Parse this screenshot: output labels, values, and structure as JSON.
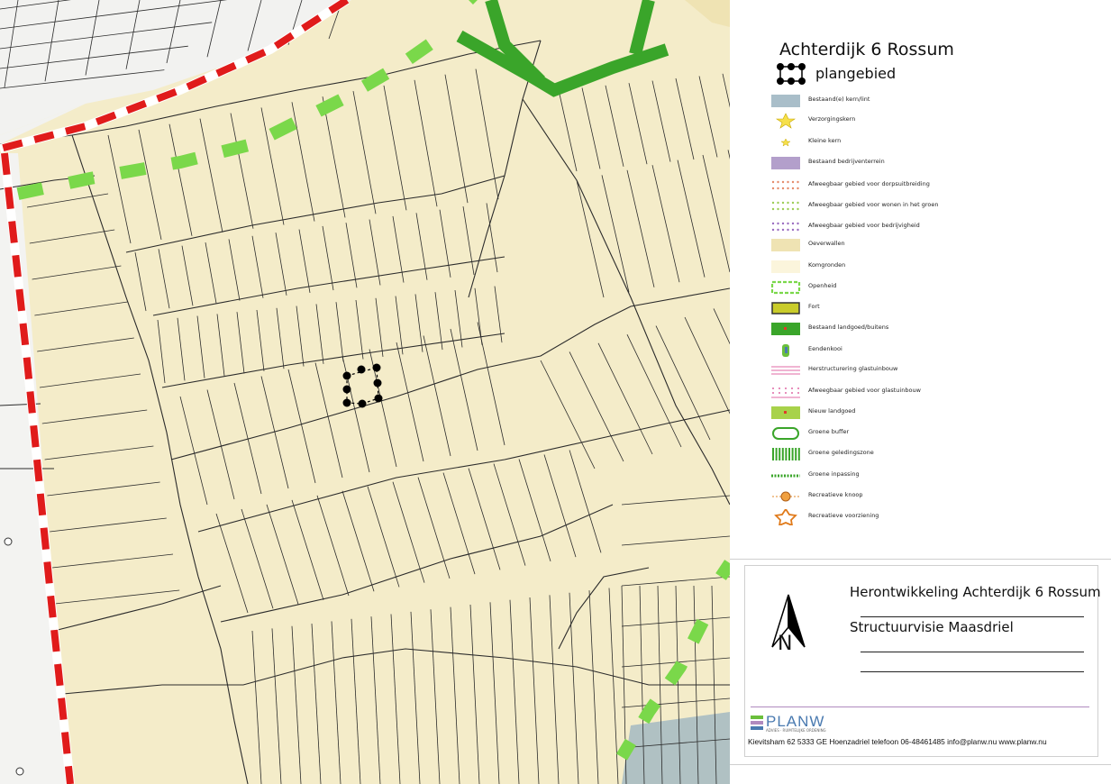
{
  "legend": {
    "title": "Achterdijk 6 Rossum",
    "plan_label": "plangebied",
    "items": [
      {
        "label": "Bestaand(e) kern/lint",
        "symbol": "fill",
        "color": "#a9bec9"
      },
      {
        "label": "Verzorgingskern",
        "symbol": "star-yellow-large"
      },
      {
        "label": "Kleine kern",
        "symbol": "star-yellow-small"
      },
      {
        "label": "Bestaand bedrijventerrein",
        "symbol": "fill",
        "color": "#b39fcb"
      },
      {
        "label": "Afweegbaar gebied voor dorpsuitbreiding",
        "symbol": "dots",
        "color": "#e58a6a"
      },
      {
        "label": "Afweegbaar gebied voor wonen in het groen",
        "symbol": "dots",
        "color": "#9ccc55"
      },
      {
        "label": "Afweegbaar gebied voor bedrijvigheid",
        "symbol": "dots",
        "color": "#9a6cc0"
      },
      {
        "label": "Oeverwallen",
        "symbol": "fill",
        "color": "#efe3b3"
      },
      {
        "label": "Komgronden",
        "symbol": "fill",
        "color": "#fbf5dc"
      },
      {
        "label": "Openheid",
        "symbol": "dashed-green"
      },
      {
        "label": "Fort",
        "symbol": "fort"
      },
      {
        "label": "Bestaand landgoed/buitens",
        "symbol": "landgoed"
      },
      {
        "label": "Eendenkooi",
        "symbol": "eendenkooi"
      },
      {
        "label": "Herstructurering glastuinbouw",
        "symbol": "pink-lines"
      },
      {
        "label": "Afweegbaar gebied voor glastuinbouw",
        "symbol": "pink-dots"
      },
      {
        "label": "Nieuw landgoed",
        "symbol": "nieuw-landgoed"
      },
      {
        "label": "Groene buffer",
        "symbol": "groene-buffer"
      },
      {
        "label": "Groene geledingszone",
        "symbol": "geleding"
      },
      {
        "label": "Groene inpassing",
        "symbol": "inpassing"
      },
      {
        "label": "Recreatieve knoop",
        "symbol": "knoop"
      },
      {
        "label": "Recreatieve voorziening",
        "symbol": "star-orange"
      }
    ]
  },
  "titleblock": {
    "title": "Herontwikkeling Achterdijk 6 Rossum",
    "subtitle": "Structuurvisie Maasdriel",
    "north_letter": "N",
    "logo_text": "PLANW",
    "logo_tagline": "ADVIES · RUIMTELIJKE ORDENING",
    "footer": "Kievitsham 62 5333 GE Hoenzadriel telefoon 06-48461485 info@planw.nu www.planw.nu"
  },
  "map": {
    "colors": {
      "background": "#f4ecc9",
      "oeverwal": "#efe3b3",
      "parcel_line": "#2b2b2b",
      "boundary_red": "#e01b1b",
      "inpassing_green": "#7ad84a",
      "geleding_green": "#3aa52a",
      "kern": "#9fb6c2"
    }
  },
  "colors": {
    "accent_purple": "#b08abf",
    "logo_green": "#6abf3c",
    "logo_blue": "#4a7ab0"
  }
}
